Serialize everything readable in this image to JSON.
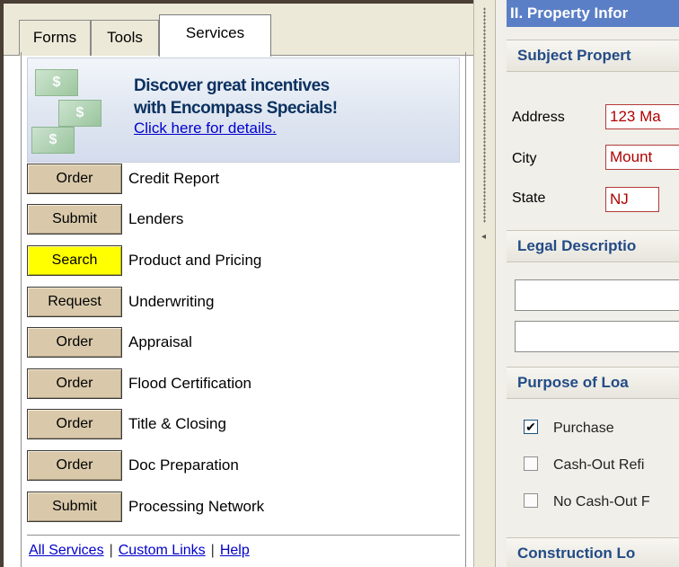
{
  "tabs": [
    {
      "label": "Forms"
    },
    {
      "label": "Tools"
    },
    {
      "label": "Services"
    }
  ],
  "promo": {
    "headline_line1": "Discover great incentives",
    "headline_line2": "with Encompass Specials!",
    "link": "Click here for details.",
    "art_bill_glyphs": [
      "$",
      "$",
      "$"
    ]
  },
  "services": [
    {
      "button": "Order",
      "label": "Credit Report"
    },
    {
      "button": "Submit",
      "label": "Lenders"
    },
    {
      "button": "Search",
      "label": "Product and Pricing"
    },
    {
      "button": "Request",
      "label": "Underwriting"
    },
    {
      "button": "Order",
      "label": "Appraisal"
    },
    {
      "button": "Order",
      "label": "Flood Certification"
    },
    {
      "button": "Order",
      "label": "Title & Closing"
    },
    {
      "button": "Order",
      "label": "Doc Preparation"
    },
    {
      "button": "Submit",
      "label": "Processing Network"
    }
  ],
  "footer": {
    "all_services": "All Services",
    "custom_links": "Custom Links",
    "help": "Help",
    "separator": "|"
  },
  "splitter": {
    "arrow": "◂"
  },
  "right": {
    "title": "II. Property Infor",
    "subject_head": "Subject Propert",
    "address_label": "Address",
    "address_value": "123 Ma",
    "city_label": "City",
    "city_value": "Mount",
    "state_label": "State",
    "state_value": "NJ",
    "legal_head": "Legal Descriptio",
    "purpose_head": "Purpose of Loa",
    "purpose_options": [
      {
        "label": "Purchase",
        "checked": true,
        "mark": "✔"
      },
      {
        "label": "Cash-Out Refi",
        "checked": false,
        "mark": ""
      },
      {
        "label": "No Cash-Out F",
        "checked": false,
        "mark": ""
      }
    ],
    "construction_head": "Construction Lo"
  },
  "colors": {
    "search_highlight": "#ffff00",
    "service_button": "#d9c9aa",
    "title_bar": "#5b7fc6",
    "section_text": "#234b86",
    "required_field_border": "#b23a3a"
  }
}
